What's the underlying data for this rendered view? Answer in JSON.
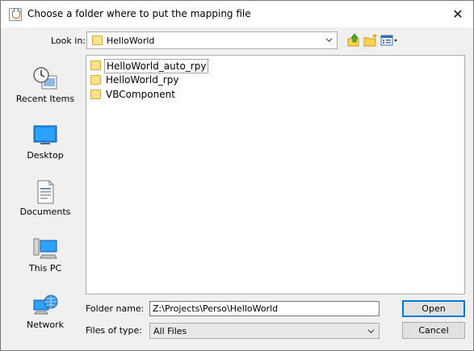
{
  "window": {
    "title": "Choose a folder where to put the mapping file",
    "close_glyph": "✕"
  },
  "toolbar": {
    "look_in_label": "Look in:",
    "look_in_value": "HelloWorld",
    "icons": [
      "up-folder-icon",
      "new-folder-icon",
      "view-menu-icon"
    ]
  },
  "places": [
    {
      "label": "Recent Items",
      "icon": "recent-items-icon"
    },
    {
      "label": "Desktop",
      "icon": "desktop-icon"
    },
    {
      "label": "Documents",
      "icon": "documents-icon"
    },
    {
      "label": "This PC",
      "icon": "this-pc-icon"
    },
    {
      "label": "Network",
      "icon": "network-icon"
    }
  ],
  "files": [
    {
      "name": "HelloWorld_auto_rpy"
    },
    {
      "name": "HelloWorld_rpy"
    },
    {
      "name": "VBComponent"
    }
  ],
  "form": {
    "folder_name_label": "Folder name:",
    "folder_name_value": "Z:\\Projects\\Perso\\HelloWorld",
    "files_of_type_label": "Files of type:",
    "files_of_type_value": "All Files"
  },
  "buttons": {
    "open": "Open",
    "cancel": "Cancel"
  },
  "colors": {
    "dialog_bg": "#f0f0f0",
    "default_button_border": "#0078d7",
    "folder_fill": "#ffe38a"
  }
}
